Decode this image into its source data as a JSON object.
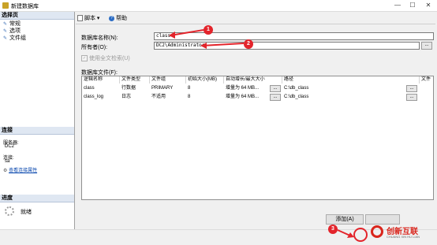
{
  "window": {
    "title": "新建数据库",
    "minimize": "—",
    "maximize": "☐",
    "close": "✕"
  },
  "left": {
    "select_page": "选择页",
    "nav": [
      "常规",
      "选项",
      "文件组"
    ],
    "connection_header": "连接",
    "server_label": "服务器:",
    "server_value": "DC2",
    "connection_label": "连接:",
    "connection_value": "sa",
    "view_props_link": "查看连接属性",
    "progress_header": "进度",
    "progress_status": "就绪"
  },
  "toolbar": {
    "script": "脚本",
    "help": "帮助"
  },
  "form": {
    "db_name_label": "数据库名称(N):",
    "db_name_value": "class",
    "owner_label": "所有者(O):",
    "owner_value": "DC2\\Administrator",
    "fulltext_label": "使用全文检索(U)",
    "files_label": "数据库文件(F):"
  },
  "grid": {
    "columns": [
      "逻辑名称",
      "文件类型",
      "文件组",
      "初始大小(MB)",
      "自动增长/最大大小",
      "路径",
      "文件"
    ],
    "rows": [
      {
        "name": "class",
        "type": "行数据",
        "group": "PRIMARY",
        "size": "8",
        "growth": "增量为 64 MB...",
        "path": "C:\\db_class"
      },
      {
        "name": "class_log",
        "type": "日志",
        "group": "不适用",
        "size": "8",
        "growth": "增量为 64 MB...",
        "path": "C:\\db_class"
      }
    ],
    "ellipsis": "..."
  },
  "buttons": {
    "add": "添加(A)"
  },
  "callouts": [
    "1",
    "2",
    "3"
  ],
  "watermark": {
    "text": "创新互联",
    "sub": "CHUANG XIN HU LIAN"
  },
  "colors": {
    "callout": "#e3242b",
    "arrow": "#e3242b",
    "section_bg": "#dfe7f2",
    "link": "#0645ad"
  }
}
